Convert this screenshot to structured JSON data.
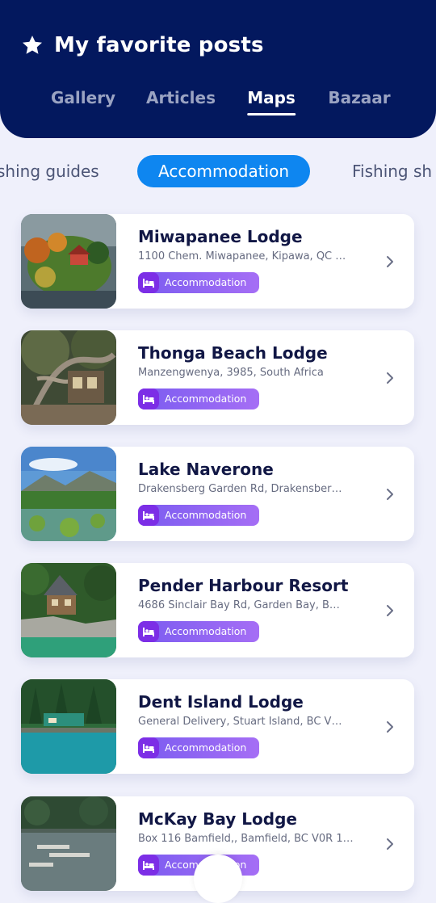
{
  "header": {
    "title": "My favorite posts",
    "icon": "star-icon",
    "tabs": [
      {
        "label": "Gallery",
        "active": false
      },
      {
        "label": "Articles",
        "active": false
      },
      {
        "label": "Maps",
        "active": true
      },
      {
        "label": "Bazaar",
        "active": false
      }
    ]
  },
  "filters": {
    "chips": [
      {
        "label": "shing guides",
        "active": false
      },
      {
        "label": "Accommodation",
        "active": true
      },
      {
        "label": "Fishing sh",
        "active": false
      }
    ]
  },
  "colors": {
    "header_bg": "#03185e",
    "page_bg": "#eff0fb",
    "chip_active": "#0e86f0",
    "badge_gradient_start": "#7b5cf0",
    "badge_gradient_end": "#a56ef5",
    "badge_icon_bg": "#7c2ee6"
  },
  "posts": [
    {
      "title": "Miwapanee Lodge",
      "address": "1100 Chem. Miwapanee, Kipawa, QC …",
      "badge": "Accommodation",
      "badge_icon": "bed-icon"
    },
    {
      "title": "Thonga Beach Lodge",
      "address": "Manzengwenya, 3985, South Africa",
      "badge": "Accommodation",
      "badge_icon": "bed-icon"
    },
    {
      "title": "Lake Naverone",
      "address": "Drakensberg Garden Rd, Drakensber…",
      "badge": "Accommodation",
      "badge_icon": "bed-icon"
    },
    {
      "title": "Pender Harbour Resort",
      "address": "4686 Sinclair Bay Rd, Garden Bay, B…",
      "badge": "Accommodation",
      "badge_icon": "bed-icon"
    },
    {
      "title": "Dent Island Lodge",
      "address": "General Delivery, Stuart Island, BC V…",
      "badge": "Accommodation",
      "badge_icon": "bed-icon"
    },
    {
      "title": "McKay Bay Lodge",
      "address": "Box 116 Bamfield,, Bamfield, BC V0R 1…",
      "badge": "Accommodation",
      "badge_icon": "bed-icon"
    }
  ]
}
